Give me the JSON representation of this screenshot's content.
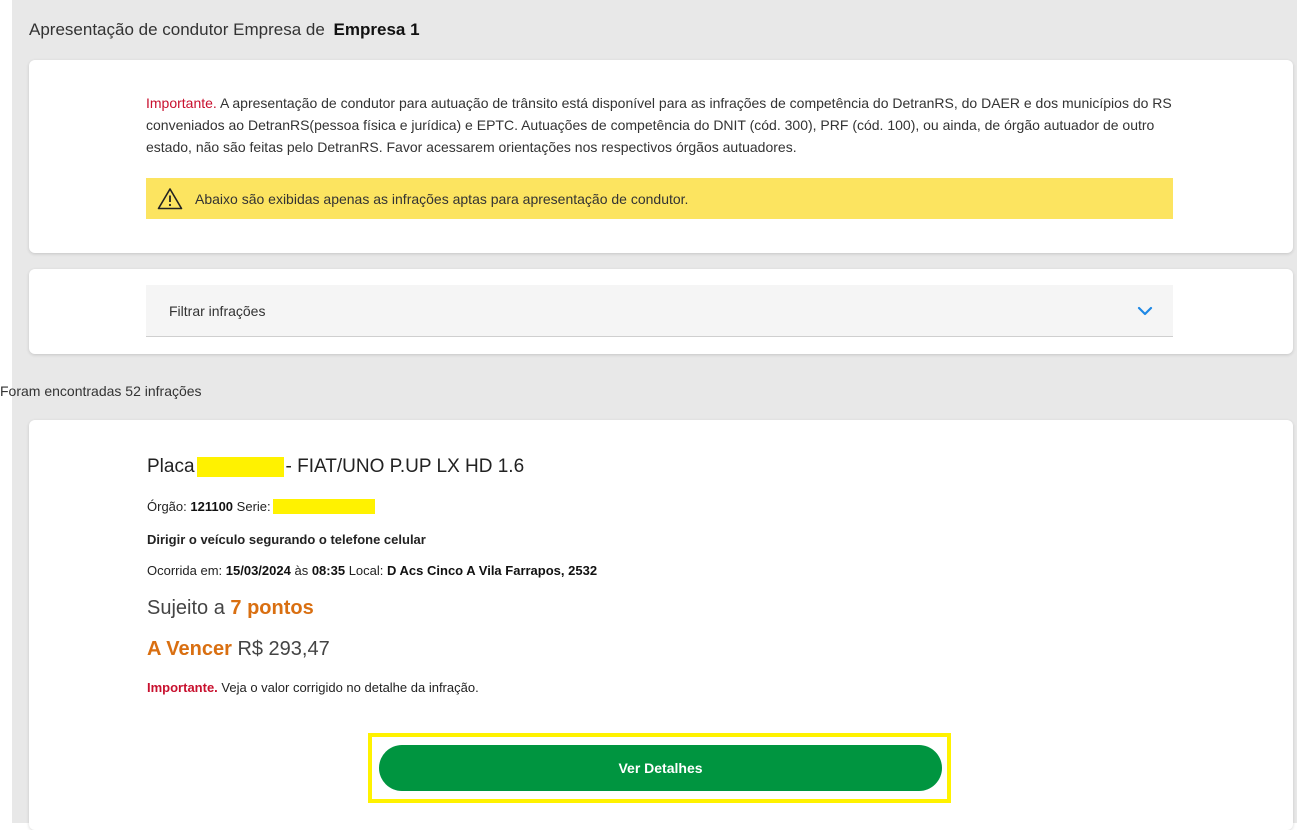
{
  "header": {
    "prefix": "Apresentação de condutor Empresa de",
    "company": "Empresa 1"
  },
  "notice": {
    "important_label": "Importante.",
    "text": " A apresentação de condutor para autuação de trânsito está disponível para as infrações de competência do DetranRS, do DAER e dos municípios do RS conveniados ao DetranRS(pessoa física e jurídica) e EPTC. Autuações de competência do DNIT (cód. 300), PRF (cód. 100), ou ainda, de órgão autuador de outro estado, não são feitas pelo DetranRS. Favor acessarem orientações nos respectivos órgãos autuadores.",
    "warning_icon": "warning-triangle-icon",
    "warning_text": "Abaixo são exibidas apenas as infrações aptas para apresentação de condutor."
  },
  "filter": {
    "label": "Filtrar infrações",
    "icon": "chevron-down-icon"
  },
  "results": {
    "count_text": "Foram encontradas 52 infrações"
  },
  "infraction": {
    "plate_label": "Placa",
    "vehicle": "- FIAT/UNO P.UP LX HD 1.6",
    "orgao_label": "Órgão:",
    "orgao_value": "121100",
    "serie_label": "Serie:",
    "description": "Dirigir o veículo segurando o telefone celular",
    "occurred_label": "Ocorrida em:",
    "date": "15/03/2024",
    "time_sep": "às",
    "time": "08:35",
    "location_label": "Local:",
    "location": "D Acs Cinco A Vila Farrapos, 2532",
    "points_prefix": "Sujeito a",
    "points_value": "7 pontos",
    "status": "A Vencer",
    "amount": "R$ 293,47",
    "important_label": "Importante.",
    "important_text": " Veja o valor corrigido no detalhe da infração.",
    "details_button": "Ver Detalhes"
  },
  "colors": {
    "accent_green": "#009540",
    "important_red": "#c8102e",
    "points_orange": "#d96f11",
    "warning_yellow": "#fce460",
    "chevron_blue": "#1e88e5"
  }
}
